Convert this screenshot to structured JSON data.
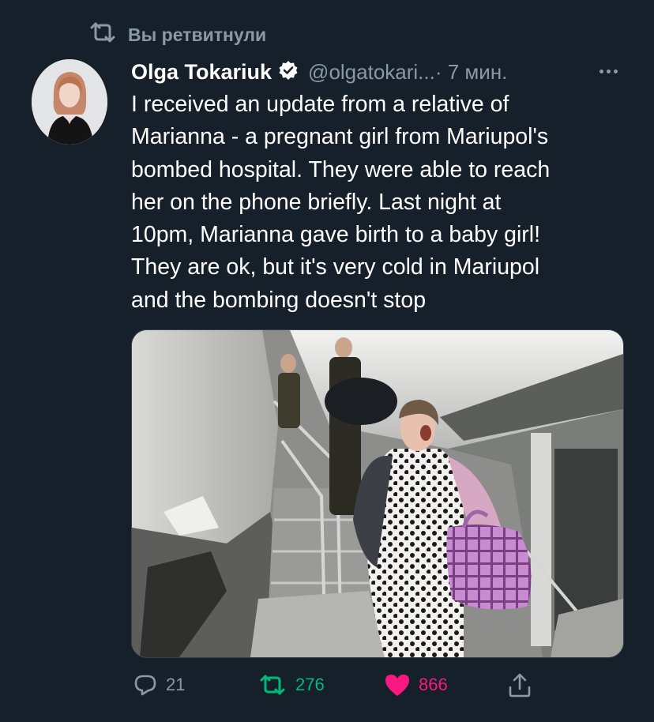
{
  "retweet": {
    "icon": "retweet-icon",
    "label": "Вы ретвитнули"
  },
  "tweet": {
    "author": {
      "name": "Olga Tokariuk",
      "handle": "@olgatokari...",
      "verified_icon": "verified-badge-icon",
      "avatar": "avatar"
    },
    "time": " · 7 мин.",
    "more_icon": "more-options-icon",
    "text": "I received an update from a relative of\nMarianna - a pregnant girl from Mariupol's\nbombed hospital. They were able to reach\nher on the phone briefly. Last night at\n10pm, Marianna gave birth to a baby girl!\nThey are ok, but it's very cold in Mariupol\nand the bombing doesn't stop",
    "media": {
      "type": "photo"
    },
    "actions": {
      "reply": {
        "icon": "reply-icon",
        "count": "21",
        "color": "#8b98a5"
      },
      "retweet": {
        "icon": "retweet-icon",
        "count": "276",
        "color": "#00ba7c"
      },
      "like": {
        "icon": "heart-icon",
        "count": "866",
        "color": "#f91880"
      },
      "share": {
        "icon": "share-icon",
        "color": "#8b98a5"
      }
    }
  },
  "colors": {
    "background": "#15202b",
    "secondary_text": "#8b98a5",
    "primary_text": "#ffffff",
    "retweet_green": "#00ba7c",
    "like_pink": "#f91880"
  }
}
